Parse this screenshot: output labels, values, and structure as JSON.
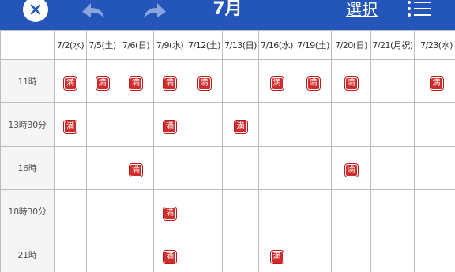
{
  "header": {
    "title": "7月",
    "select_label": "選択"
  },
  "colors": {
    "header_bg": "#2455b8",
    "badge_bg": "#d12b2b",
    "grid_line": "#bcbcbc"
  },
  "icons": {
    "close": "close-icon",
    "back": "undo-arrow-icon",
    "forward": "redo-arrow-icon",
    "list": "list-icon"
  },
  "table": {
    "dates": [
      "7/2(水)",
      "7/5(土)",
      "7/6(日)",
      "7/9(水)",
      "7/12(土)",
      "7/13(日)",
      "7/16(水)",
      "7/19(土)",
      "7/20(日)",
      "7/21(月祝)",
      "7/23(水)"
    ],
    "badge_label": "満",
    "rows": [
      {
        "time": "11時",
        "full": [
          true,
          true,
          true,
          true,
          true,
          false,
          true,
          true,
          true,
          false,
          true
        ]
      },
      {
        "time": "13時30分",
        "full": [
          true,
          false,
          false,
          true,
          false,
          true,
          false,
          false,
          false,
          false,
          false
        ]
      },
      {
        "time": "16時",
        "full": [
          false,
          false,
          true,
          false,
          false,
          false,
          false,
          false,
          true,
          false,
          false
        ]
      },
      {
        "time": "18時30分",
        "full": [
          false,
          false,
          false,
          true,
          false,
          false,
          false,
          false,
          false,
          false,
          false
        ]
      },
      {
        "time": "21時",
        "full": [
          false,
          false,
          false,
          true,
          false,
          false,
          true,
          false,
          false,
          false,
          false
        ]
      }
    ]
  }
}
